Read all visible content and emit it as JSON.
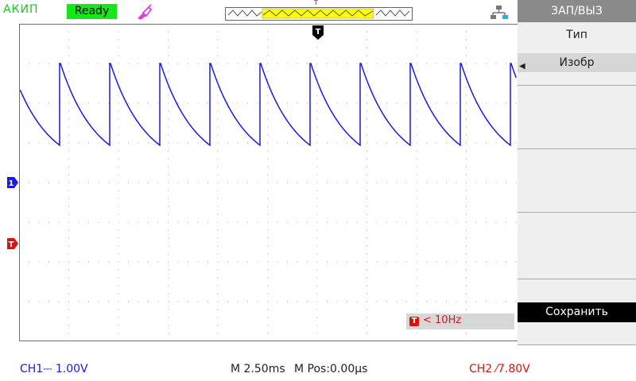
{
  "header": {
    "brand": "АКИП",
    "status": "Ready",
    "trigger_marker": "T"
  },
  "menu": {
    "title": "ЗАП/ВЫЗ",
    "type_label": "Тип",
    "type_value": "Изобр",
    "save_label": "Сохранить"
  },
  "measure": {
    "freq_text": "< 10Hz"
  },
  "footer": {
    "ch1": "CH1⎓ 1.00V",
    "timebase": "M 2.50ms",
    "mpos": "M Pos:0.00µs",
    "ch2": "CH2 ⁄7.80V"
  },
  "colors": {
    "ch1": "#1a1ae0",
    "ch2": "#e01010",
    "status_bg": "#19e619",
    "brand": "#19c819"
  },
  "icons": {
    "probe": "probe-icon",
    "network": "network-icon",
    "trigger_position": "trigger-position-icon",
    "ch1_marker": "ch1-marker-icon",
    "ch2_marker": "ch2-marker-icon"
  }
}
